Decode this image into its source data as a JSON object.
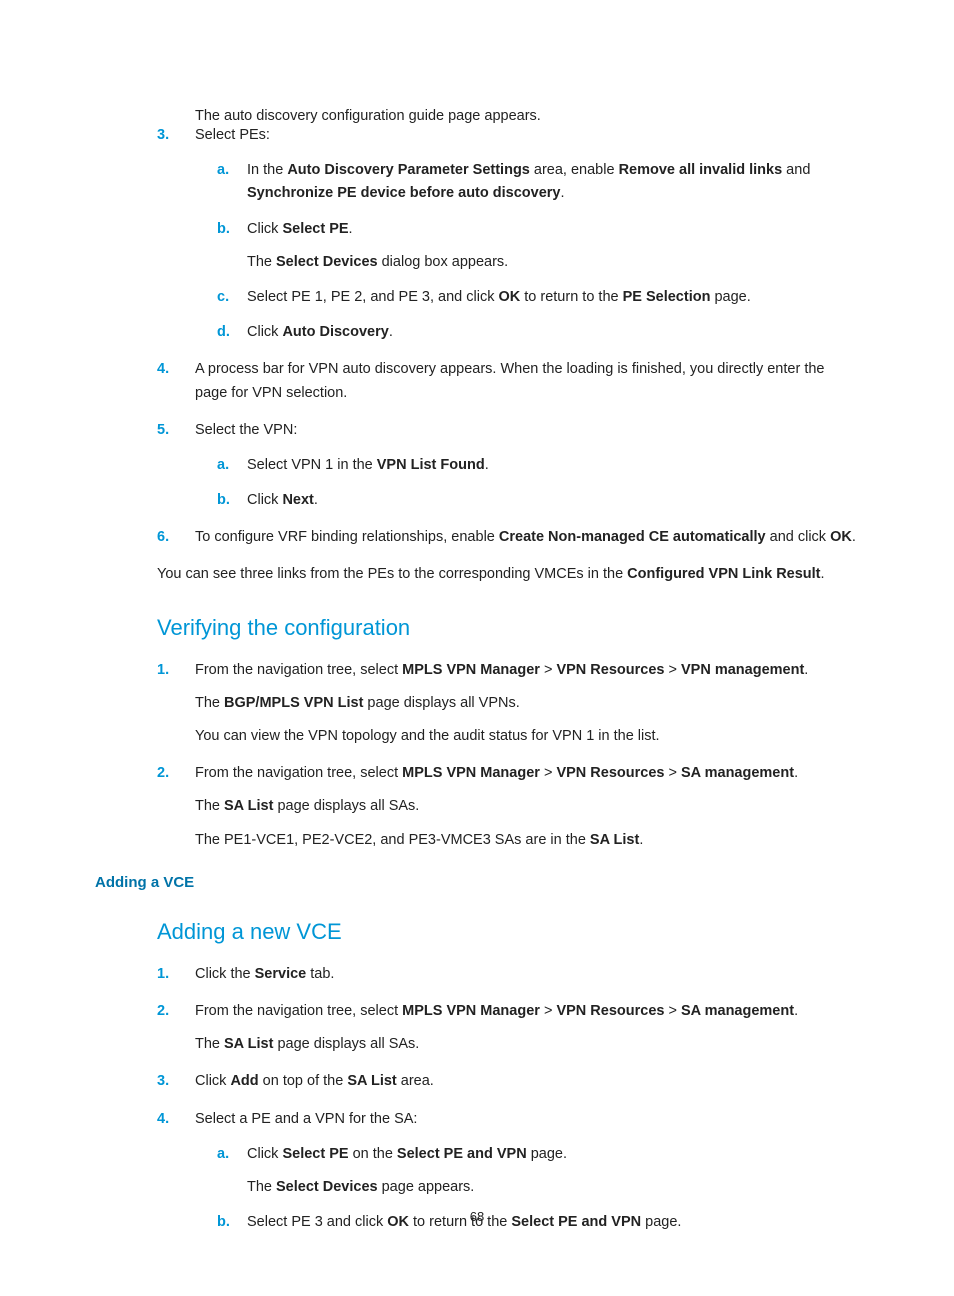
{
  "toptext": "The auto discovery configuration guide page appears.",
  "s3": {
    "num": "3.",
    "title": "Select PEs:",
    "a": {
      "m": "a.",
      "t1": "In the ",
      "b1": "Auto Discovery Parameter Settings",
      "t2": " area, enable ",
      "b2": "Remove all invalid links",
      "t3": " and ",
      "b3": "Synchronize PE device before auto discovery",
      "t4": "."
    },
    "b": {
      "m": "b.",
      "t1": "Click ",
      "b1": "Select PE",
      "t2": ".",
      "p1a": "The ",
      "p1b": "Select Devices",
      "p1c": " dialog box appears."
    },
    "c": {
      "m": "c.",
      "t1": "Select PE 1, PE 2, and PE 3, and click ",
      "b1": "OK",
      "t2": " to return to the ",
      "b2": "PE Selection",
      "t3": " page."
    },
    "d": {
      "m": "d.",
      "t1": "Click ",
      "b1": "Auto Discovery",
      "t2": "."
    }
  },
  "s4": {
    "num": "4.",
    "t": "A process bar for VPN auto discovery appears. When the loading is finished, you directly enter the page for VPN selection."
  },
  "s5": {
    "num": "5.",
    "title": "Select the VPN:",
    "a": {
      "m": "a.",
      "t1": "Select VPN 1 in the ",
      "b1": "VPN List Found",
      "t2": "."
    },
    "b": {
      "m": "b.",
      "t1": "Click ",
      "b1": "Next",
      "t2": "."
    }
  },
  "s6": {
    "num": "6.",
    "t1": "To configure VRF binding relationships, enable ",
    "b1": "Create Non-managed CE automatically",
    "t2": " and click ",
    "b2": "OK",
    "t3": "."
  },
  "postpara": {
    "t1": "You can see three links from the PEs to the corresponding VMCEs in the ",
    "b1": "Configured VPN Link Result",
    "t2": "."
  },
  "verify": {
    "heading": "Verifying the configuration",
    "s1": {
      "num": "1.",
      "l1a": "From the navigation tree, select ",
      "l1b": "MPLS VPN Manager",
      "l1c": " > ",
      "l1d": "VPN Resources",
      "l1e": " > ",
      "l1f": "VPN management",
      "l1g": ".",
      "l2a": "The ",
      "l2b": "BGP/MPLS VPN List",
      "l2c": " page displays all VPNs.",
      "l3": "You can view the VPN topology and the audit status for VPN 1 in the list."
    },
    "s2": {
      "num": "2.",
      "l1a": "From the navigation tree, select ",
      "l1b": "MPLS VPN Manager",
      "l1c": " > ",
      "l1d": "VPN Resources",
      "l1e": " > ",
      "l1f": "SA management",
      "l1g": ".",
      "l2a": "The ",
      "l2b": "SA List",
      "l2c": " page displays all SAs.",
      "l3a": "The PE1-VCE1, PE2-VCE2, and PE3-VMCE3 SAs are in the ",
      "l3b": "SA List",
      "l3c": "."
    }
  },
  "addvce": {
    "heading": "Adding a VCE",
    "sub": "Adding a new VCE",
    "s1": {
      "num": "1.",
      "t1": "Click the ",
      "b1": "Service",
      "t2": " tab."
    },
    "s2": {
      "num": "2.",
      "l1a": "From the navigation tree, select ",
      "l1b": "MPLS VPN Manager",
      "l1c": " > ",
      "l1d": "VPN Resources",
      "l1e": " > ",
      "l1f": "SA management",
      "l1g": ".",
      "l2a": "The ",
      "l2b": "SA List",
      "l2c": " page displays all SAs."
    },
    "s3": {
      "num": "3.",
      "t1": "Click ",
      "b1": "Add",
      "t2": " on top of the ",
      "b2": "SA List",
      "t3": " area."
    },
    "s4": {
      "num": "4.",
      "title": "Select a PE and a VPN for the SA:",
      "a": {
        "m": "a.",
        "t1": "Click ",
        "b1": "Select PE",
        "t2": " on the ",
        "b2": "Select PE and VPN",
        "t3": " page.",
        "p1a": "The ",
        "p1b": "Select Devices",
        "p1c": " page appears."
      },
      "b": {
        "m": "b.",
        "t1": "Select PE 3 and click ",
        "b1": "OK",
        "t2": " to return to the ",
        "b2": "Select PE and VPN",
        "t3": " page."
      }
    }
  },
  "pagenum": "68"
}
